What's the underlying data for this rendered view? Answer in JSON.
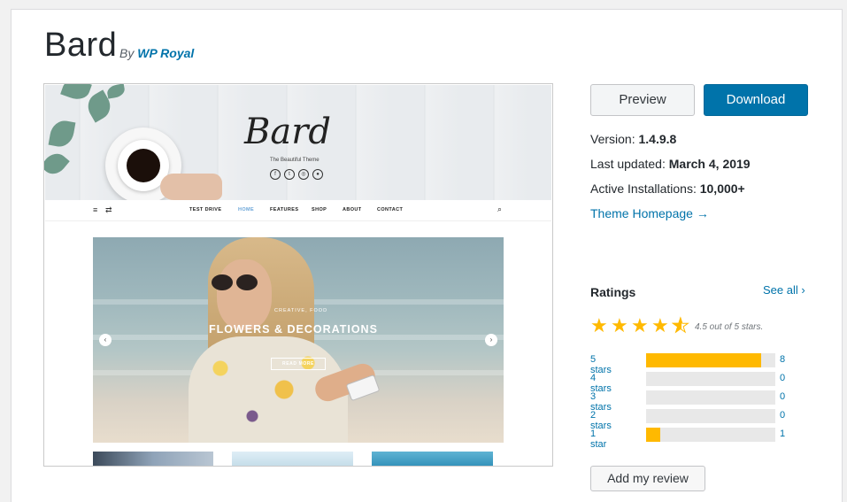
{
  "theme": {
    "name": "Bard",
    "by": "By",
    "author": "WP Royal"
  },
  "preview_shot": {
    "logo": "Bard",
    "tagline": "The Beautiful Theme",
    "nav": [
      "TEST DRIVE",
      "HOME",
      "FEATURES",
      "SHOP",
      "ABOUT",
      "CONTACT"
    ],
    "slide_kicker": "CREATIVE, FOOD",
    "slide_heading": "FLOWERS & DECORATIONS",
    "slide_button": "READ MORE"
  },
  "actions": {
    "preview": "Preview",
    "download": "Download"
  },
  "meta": {
    "version_label": "Version:",
    "version": "1.4.9.8",
    "updated_label": "Last updated:",
    "updated": "March 4, 2019",
    "installs_label": "Active Installations:",
    "installs": "10,000+",
    "homepage": "Theme Homepage →"
  },
  "ratings": {
    "title": "Ratings",
    "see_all": "See all",
    "average": 4.5,
    "average_text": "4.5 out of 5 stars.",
    "rows": [
      {
        "label": "5 stars",
        "count": "8",
        "fraction": 0.89
      },
      {
        "label": "4 stars",
        "count": "0",
        "fraction": 0
      },
      {
        "label": "3 stars",
        "count": "0",
        "fraction": 0
      },
      {
        "label": "2 stars",
        "count": "0",
        "fraction": 0
      },
      {
        "label": "1 star",
        "count": "1",
        "fraction": 0.11
      }
    ],
    "review_button": "Add my review"
  },
  "colors": {
    "link": "#0073aa",
    "star": "#ffb900",
    "download_bg": "#0073aa"
  }
}
